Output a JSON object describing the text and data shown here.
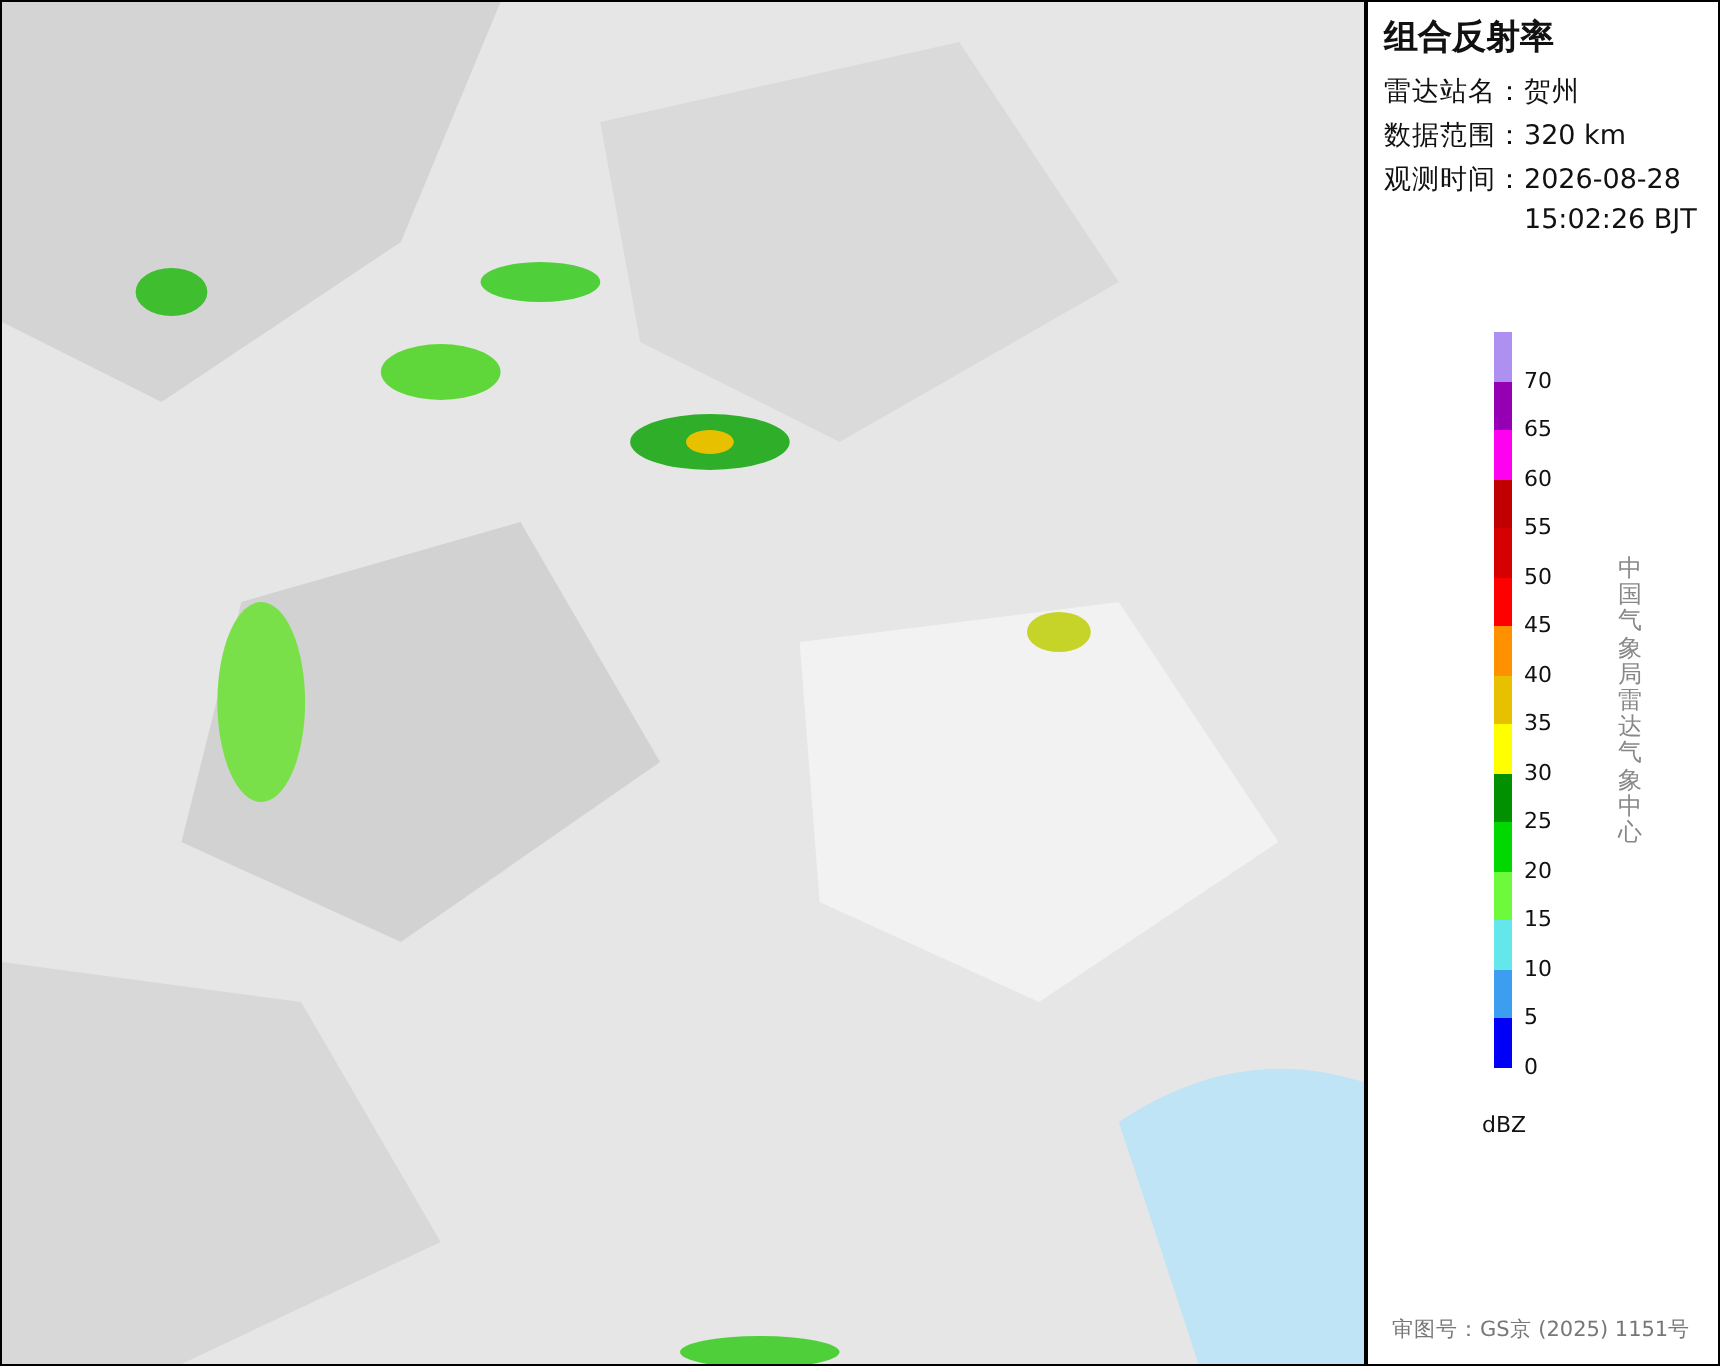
{
  "panel": {
    "title": "组合反射率",
    "info": [
      {
        "label": "雷达站名：",
        "value_lines": [
          "贺州"
        ]
      },
      {
        "label": "数据范围：",
        "value_lines": [
          "320 km"
        ]
      },
      {
        "label": "观测时间：",
        "value_lines": [
          "2026-08-28",
          "15:02:26 BJT"
        ]
      }
    ],
    "legend": {
      "items": [
        {
          "color": "#ad90f0",
          "label": "70"
        },
        {
          "color": "#9600b4",
          "label": "65"
        },
        {
          "color": "#ff00f0",
          "label": "60"
        },
        {
          "color": "#c00000",
          "label": "55"
        },
        {
          "color": "#d60000",
          "label": "50"
        },
        {
          "color": "#ff0000",
          "label": "45"
        },
        {
          "color": "#ff9000",
          "label": "40"
        },
        {
          "color": "#e7c000",
          "label": "35"
        },
        {
          "color": "#ffff00",
          "label": "30"
        },
        {
          "color": "#019000",
          "label": "25"
        },
        {
          "color": "#00d800",
          "label": "20"
        },
        {
          "color": "#6dfa3d",
          "label": "15"
        },
        {
          "color": "#64e7eb",
          "label": "10"
        },
        {
          "color": "#3c9ef0",
          "label": "5"
        },
        {
          "color": "#0000f6",
          "label": "0"
        }
      ],
      "unit": "dBZ"
    },
    "credit": "中国气象局雷达气象中心",
    "approval": "审图号：GS京 (2025) 1151号"
  }
}
